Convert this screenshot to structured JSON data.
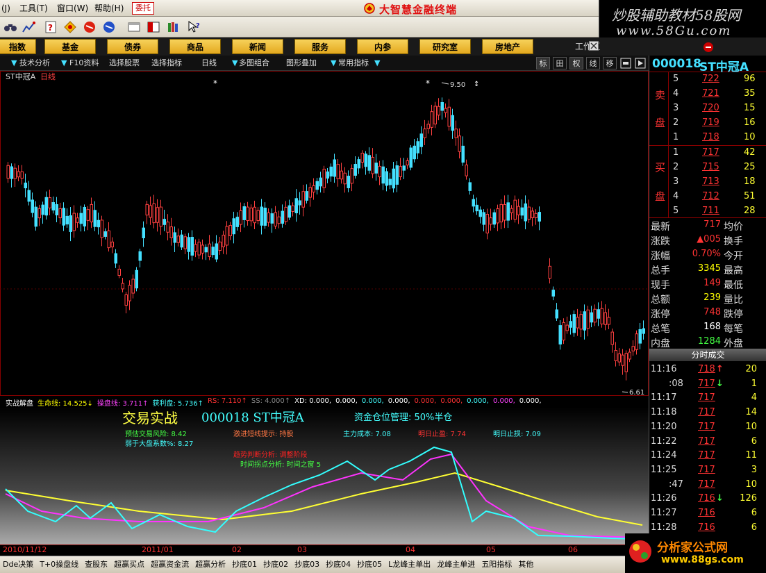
{
  "menu": {
    "items": [
      "(J)",
      "工具(T)",
      "窗口(W)",
      "帮助(H)"
    ],
    "delegate": "委托",
    "title": "大智慧金融终端"
  },
  "watermark": {
    "line1": "炒股辅助教材58股网",
    "line2": "www.58Gu.com",
    "bottom_line1": "分析家公式网",
    "bottom_line2": "www.88gs.com"
  },
  "navbar": {
    "items": [
      "指数",
      "基金",
      "债券",
      "商品",
      "新闻",
      "服务",
      "内参",
      "研究室",
      "房地产"
    ],
    "workarea": "工作区"
  },
  "chartbar": {
    "items": [
      "技术分析",
      "F10资料",
      "选择股票",
      "选择指标",
      "日线",
      "多图组合",
      "图形叠加",
      "常用指标"
    ],
    "right_buttons": [
      "标",
      "田",
      "权",
      "线",
      "移"
    ]
  },
  "chart": {
    "name": "ST中冠A",
    "period": "日线",
    "high_label": "9.50",
    "low_label": "6.61"
  },
  "indicator_line": [
    {
      "t": "实战解盘",
      "c": "#ffffff"
    },
    {
      "t": "生命线: 14.525↓",
      "c": "#ffff00"
    },
    {
      "t": "操盘线: 3.711↑",
      "c": "#ff44ff"
    },
    {
      "t": "获利盘: 5.736↑",
      "c": "#44ffff"
    },
    {
      "t": "RS: 7.110↑",
      "c": "#ff3333"
    },
    {
      "t": "SS: 4.000↑",
      "c": "#888888"
    },
    {
      "t": "XD: 0.000,",
      "c": "#ffffff"
    },
    {
      "t": "0.000,",
      "c": "#ffffff"
    },
    {
      "t": "0.000,",
      "c": "#44ffff"
    },
    {
      "t": "0.000,",
      "c": "#ffffff"
    },
    {
      "t": "0.000,",
      "c": "#ff3333"
    },
    {
      "t": "0.000,",
      "c": "#ff3333"
    },
    {
      "t": "0.000,",
      "c": "#44ffff"
    },
    {
      "t": "0.000,",
      "c": "#ff44ff"
    },
    {
      "t": "0.000,",
      "c": "#ffffff"
    }
  ],
  "subpanel": {
    "title": "交易实战",
    "code": "000018 ST中冠A",
    "position": "资金仓位管理: 50%半仓",
    "risk": "预估交易风险: 8.42",
    "weak": "弱于大盘系数%: 8.27",
    "hint": "激进短线提示: 持股",
    "cost": "主力成本: 7.08",
    "tmrw_stop_profit": "明日止盈: 7.74",
    "tmrw_stop_loss": "明日止损: 7.09",
    "trend": "趋势判断分析: 调整阶段",
    "timing": "时间拐点分析: 时间之窗 5"
  },
  "dates": [
    "2010/11/12",
    "2011/01",
    "02",
    "03",
    "04",
    "05",
    "06"
  ],
  "bottom_tabs": [
    "Dde决策",
    "T+0操盘线",
    "查股东",
    "超赢买点",
    "超赢资金流",
    "超赢分析",
    "抄底01",
    "抄底02",
    "抄底03",
    "抄底04",
    "抄底05",
    "L龙峰主单出",
    "龙峰主单进",
    "五阳指标",
    "其他"
  ],
  "quote": {
    "code": "000018",
    "name": "ST中冠A",
    "sell_label": [
      "卖",
      "盘"
    ],
    "buy_label": [
      "买",
      "盘"
    ],
    "asks": [
      {
        "n": "5",
        "p": "722",
        "v": "96"
      },
      {
        "n": "4",
        "p": "721",
        "v": "35"
      },
      {
        "n": "3",
        "p": "720",
        "v": "15"
      },
      {
        "n": "2",
        "p": "719",
        "v": "16"
      },
      {
        "n": "1",
        "p": "718",
        "v": "10"
      }
    ],
    "bids": [
      {
        "n": "1",
        "p": "717",
        "v": "42"
      },
      {
        "n": "2",
        "p": "715",
        "v": "25"
      },
      {
        "n": "3",
        "p": "713",
        "v": "18"
      },
      {
        "n": "4",
        "p": "712",
        "v": "51"
      },
      {
        "n": "5",
        "p": "711",
        "v": "28"
      }
    ],
    "stats": [
      {
        "k": "最新",
        "v": "717",
        "k2": "均价",
        "c": "#ff3333"
      },
      {
        "k": "涨跌",
        "v": "▲005",
        "k2": "换手",
        "c": "#ff3333"
      },
      {
        "k": "涨幅",
        "v": "0.70%",
        "k2": "今开",
        "c": "#ff3333"
      },
      {
        "k": "总手",
        "v": "3345",
        "k2": "最高",
        "c": "#ffff00"
      },
      {
        "k": "现手",
        "v": "149",
        "k2": "最低",
        "c": "#ff3333"
      },
      {
        "k": "总额",
        "v": "239",
        "k2": "量比",
        "c": "#ffff00"
      },
      {
        "k": "涨停",
        "v": "748",
        "k2": "跌停",
        "c": "#ff3333"
      },
      {
        "k": "总笔",
        "v": "168",
        "k2": "每笔",
        "c": "#ffffff"
      },
      {
        "k": "内盘",
        "v": "1284",
        "k2": "外盘",
        "c": "#44ff44"
      }
    ],
    "ticks_title": "分时成交",
    "ticks": [
      {
        "t": "11:16",
        "p": "718",
        "a": "↑",
        "v": "20",
        "c": "#ff3333"
      },
      {
        "t": ":08",
        "p": "717",
        "a": "↓",
        "v": "1",
        "c": "#44ff44"
      },
      {
        "t": "11:17",
        "p": "717",
        "a": "",
        "v": "4",
        "c": "#ff3333"
      },
      {
        "t": "11:18",
        "p": "717",
        "a": "",
        "v": "14",
        "c": "#ff3333"
      },
      {
        "t": "11:20",
        "p": "717",
        "a": "",
        "v": "10",
        "c": "#ff3333"
      },
      {
        "t": "11:22",
        "p": "717",
        "a": "",
        "v": "6",
        "c": "#ff3333"
      },
      {
        "t": "11:24",
        "p": "717",
        "a": "",
        "v": "11",
        "c": "#ff3333"
      },
      {
        "t": "11:25",
        "p": "717",
        "a": "",
        "v": "3",
        "c": "#ff3333"
      },
      {
        "t": ":47",
        "p": "717",
        "a": "",
        "v": "10",
        "c": "#ff3333"
      },
      {
        "t": "11:26",
        "p": "716",
        "a": "↓",
        "v": "126",
        "c": "#44ff44"
      },
      {
        "t": "11:27",
        "p": "716",
        "a": "",
        "v": "6",
        "c": "#ff3333"
      },
      {
        "t": "11:28",
        "p": "716",
        "a": "",
        "v": "6",
        "c": "#ff3333"
      }
    ]
  }
}
